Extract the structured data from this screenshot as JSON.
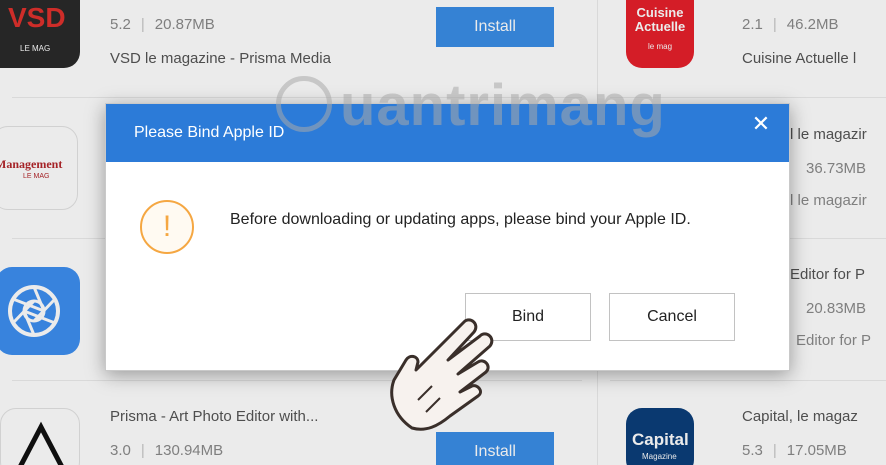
{
  "apps": [
    {
      "id": "vsd",
      "rating": "5.2",
      "size": "20.87MB",
      "name": "VSD le magazine - Prisma Media",
      "install_label": "Install",
      "icon_text": "VSD",
      "icon_sub": "LE MAG"
    },
    {
      "id": "cuisine",
      "rating": "2.1",
      "size": "46.2MB",
      "name": "Cuisine Actuelle l",
      "icon_text": "Cuisine Actuelle",
      "icon_sub": "le mag"
    },
    {
      "id": "management",
      "icon_text": "Management",
      "icon_sub": "LE MAG",
      "name_partial": "l le magazir",
      "size": "36.73MB",
      "name2_partial": "l le magazir"
    },
    {
      "id": "prisma-editor",
      "icon_text": "",
      "name_partial": "Editor for P",
      "size": "20.83MB",
      "name2_partial": "Editor for P"
    },
    {
      "id": "prisma",
      "rating": "3.0",
      "size": "130.94MB",
      "name": "Prisma - Art Photo Editor with...",
      "install_label": "Install"
    },
    {
      "id": "capital",
      "rating": "5.3",
      "size": "17.05MB",
      "name": "Capital, le magaz",
      "icon_text": "Capital",
      "icon_sub": "Magazine"
    }
  ],
  "dialog": {
    "title": "Please Bind Apple ID",
    "close_glyph": "✕",
    "warning_glyph": "!",
    "message": "Before downloading or updating apps, please bind your Apple ID.",
    "bind_label": "Bind",
    "cancel_label": "Cancel"
  },
  "watermark": "uantrimang",
  "colors": {
    "accent": "#2c7bd8",
    "install": "#3a8ee6",
    "warning": "#f5a742"
  }
}
